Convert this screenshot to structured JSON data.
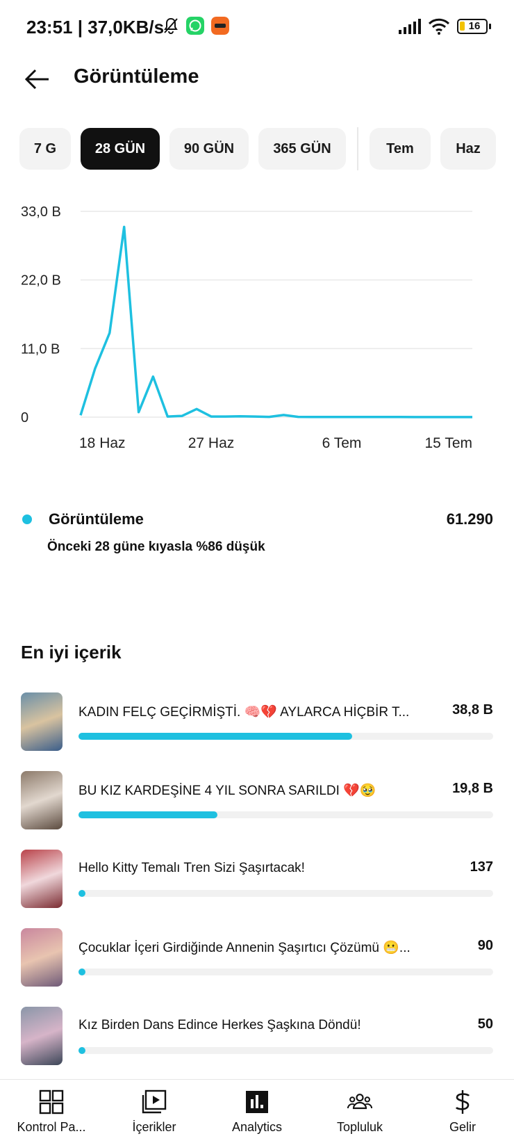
{
  "status_bar": {
    "time_speed": "23:51 | 37,0KB/s",
    "battery": "16"
  },
  "header": {
    "title": "Görüntüleme"
  },
  "periods": [
    {
      "label": "7 G",
      "active": false
    },
    {
      "label": "28 GÜN",
      "active": true
    },
    {
      "label": "90 GÜN",
      "active": false
    },
    {
      "label": "365 GÜN",
      "active": false
    },
    {
      "label": "Tem",
      "active": false
    },
    {
      "label": "Haz",
      "active": false
    }
  ],
  "chart_data": {
    "type": "line",
    "x": [
      "18 Haz",
      "19 Haz",
      "20 Haz",
      "21 Haz",
      "22 Haz",
      "23 Haz",
      "24 Haz",
      "25 Haz",
      "26 Haz",
      "27 Haz",
      "28 Haz",
      "29 Haz",
      "30 Haz",
      "1 Tem",
      "2 Tem",
      "3 Tem",
      "4 Tem",
      "5 Tem",
      "6 Tem",
      "7 Tem",
      "8 Tem",
      "9 Tem",
      "10 Tem",
      "11 Tem",
      "12 Tem",
      "13 Tem",
      "14 Tem",
      "15 Tem"
    ],
    "x_tick_labels": [
      "18 Haz",
      "27 Haz",
      "6 Tem",
      "15 Tem"
    ],
    "y_tick_labels": [
      "0",
      "11,0 B",
      "22,0 B",
      "33,0 B"
    ],
    "ylim": [
      0,
      33000
    ],
    "series": [
      {
        "name": "Görüntüleme",
        "color": "#1ec0e0",
        "values": [
          300,
          7800,
          13500,
          30500,
          800,
          6500,
          100,
          200,
          1300,
          100,
          100,
          150,
          100,
          50,
          350,
          50,
          30,
          30,
          20,
          20,
          20,
          30,
          20,
          15,
          10,
          10,
          10,
          10
        ]
      }
    ],
    "grid": true
  },
  "summary": {
    "label": "Görüntüleme",
    "value": "61.290",
    "comparison": "Önceki 28 güne kıyasla %86 düşük"
  },
  "top_content": {
    "title": "En iyi içerik",
    "items": [
      {
        "title": "KADIN FELÇ GEÇİRMİŞTİ. 🧠💔 AYLARCA HİÇBİR T...",
        "value": "38,8 B",
        "fill": 0.66,
        "thumb_colors": [
          "#6a8fa8",
          "#d9c3a0",
          "#3a5d8a"
        ]
      },
      {
        "title": "BU KIZ KARDEŞİNE 4 YIL SONRA SARILDI 💔🥹",
        "value": "19,8 B",
        "fill": 0.335,
        "thumb_colors": [
          "#8c7a6a",
          "#e2d8cf",
          "#5b4a3e"
        ]
      },
      {
        "title": "Hello Kitty Temalı Tren Sizi Şaşırtacak!",
        "value": "137",
        "fill": 0.0,
        "thumb_colors": [
          "#b9434a",
          "#f0d8dc",
          "#7a2a30"
        ]
      },
      {
        "title": "Çocuklar İçeri Girdiğinde Annenin Şaşırtıcı Çözümü 😬...",
        "value": "90",
        "fill": 0.0,
        "thumb_colors": [
          "#c9879e",
          "#e8c4b0",
          "#6f5a78"
        ]
      },
      {
        "title": "Kız Birden Dans Edince Herkes Şaşkına Döndü!",
        "value": "50",
        "fill": 0.0,
        "thumb_colors": [
          "#8a96a8",
          "#d6b4c8",
          "#3c4658"
        ]
      }
    ]
  },
  "bottom_nav": [
    {
      "label": "Kontrol Pa...",
      "icon": "dashboard-icon"
    },
    {
      "label": "İçerikler",
      "icon": "content-play-icon"
    },
    {
      "label": "Analytics",
      "icon": "analytics-icon"
    },
    {
      "label": "Topluluk",
      "icon": "community-icon"
    },
    {
      "label": "Gelir",
      "icon": "dollar-icon"
    }
  ]
}
